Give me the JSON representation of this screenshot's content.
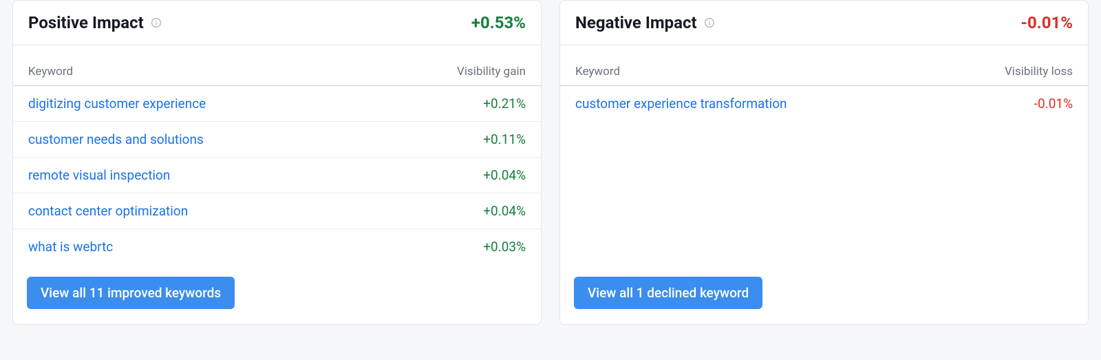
{
  "positive": {
    "title": "Positive Impact",
    "total": "+0.53%",
    "col_keyword": "Keyword",
    "col_value": "Visibility gain",
    "rows": [
      {
        "keyword": "digitizing customer experience",
        "value": "+0.21%"
      },
      {
        "keyword": "customer needs and solutions",
        "value": "+0.11%"
      },
      {
        "keyword": "remote visual inspection",
        "value": "+0.04%"
      },
      {
        "keyword": "contact center optimization",
        "value": "+0.04%"
      },
      {
        "keyword": "what is webrtc",
        "value": "+0.03%"
      }
    ],
    "button": "View all 11 improved keywords"
  },
  "negative": {
    "title": "Negative Impact",
    "total": "-0.01%",
    "col_keyword": "Keyword",
    "col_value": "Visibility loss",
    "rows": [
      {
        "keyword": "customer experience transformation",
        "value": "-0.01%"
      }
    ],
    "button": "View all 1 declined keyword"
  }
}
